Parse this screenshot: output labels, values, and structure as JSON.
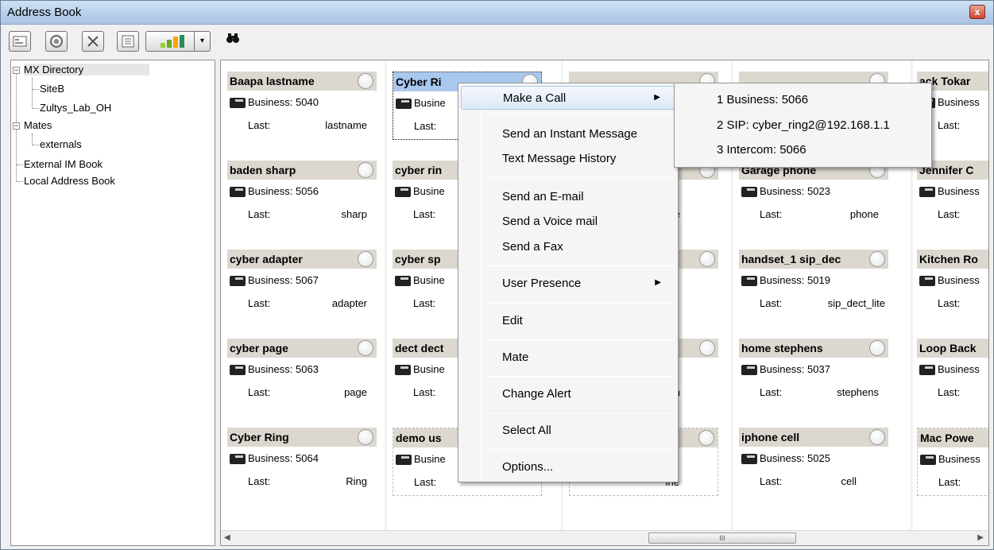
{
  "window": {
    "title": "Address Book",
    "close_label": "x"
  },
  "toolbar": {
    "buttons": [
      "new-contact-icon",
      "presence-icon",
      "delete-icon",
      "properties-icon",
      "chart-icon"
    ],
    "dropdown_arrow": "▾",
    "find_icon": "binoculars-icon"
  },
  "tree": {
    "items": [
      {
        "label": "MX Directory",
        "expander": "−"
      },
      {
        "label": "SiteB"
      },
      {
        "label": "Zultys_Lab_OH"
      },
      {
        "label": "Mates",
        "expander": "−"
      },
      {
        "label": "externals"
      },
      {
        "label": "External IM Book"
      },
      {
        "label": "Local Address Book"
      }
    ]
  },
  "contacts": [
    {
      "name": "Baapa lastname",
      "business_label": "Business:",
      "business": "5040",
      "last_label": "Last:",
      "last": "lastname"
    },
    {
      "name": "baden sharp",
      "business_label": "Business:",
      "business": "5056",
      "last_label": "Last:",
      "last": "sharp"
    },
    {
      "name": "cyber adapter",
      "business_label": "Business:",
      "business": "5067",
      "last_label": "Last:",
      "last": "adapter"
    },
    {
      "name": "cyber page",
      "business_label": "Business:",
      "business": "5063",
      "last_label": "Last:",
      "last": "page"
    },
    {
      "name": "Cyber Ring",
      "business_label": "Business:",
      "business": "5064",
      "last_label": "Last:",
      "last": "Ring"
    },
    {
      "name": "Cyber Ri",
      "business_label": "Busine",
      "last_label": "Last:"
    },
    {
      "name": "cyber rin",
      "business_label": "Busine",
      "last_label": "Last:"
    },
    {
      "name": "cyber sp",
      "business_label": "Busine",
      "last_label": "Last:"
    },
    {
      "name": "dect dect",
      "business_label": "Busine",
      "last_label": "Last:"
    },
    {
      "name": "demo us",
      "business_label": "Busine",
      "last_label": "Last:"
    },
    {
      "fragment": "e"
    },
    {
      "fragment": "n"
    },
    {
      "fragment": "ine"
    },
    {
      "name": "Garage phone",
      "business_label": "Business:",
      "business": "5023",
      "last_label": "Last:",
      "last": "phone"
    },
    {
      "name": "handset_1 sip_dec",
      "business_label": "Business:",
      "business": "5019",
      "last_label": "Last:",
      "last": "sip_dect_lite"
    },
    {
      "name": "home stephens",
      "business_label": "Business:",
      "business": "5037",
      "last_label": "Last:",
      "last": "stephens"
    },
    {
      "name": "iphone cell",
      "business_label": "Business:",
      "business": "5025",
      "last_label": "Last:",
      "last": "cell"
    },
    {
      "name": "ack Tokar",
      "business_label": "Business",
      "last_label": "Last:"
    },
    {
      "name": "Jennifer C",
      "business_label": "Business",
      "last_label": "Last:"
    },
    {
      "name": "Kitchen Ro",
      "business_label": "Business",
      "last_label": "Last:"
    },
    {
      "name": "Loop Back",
      "business_label": "Business",
      "last_label": "Last:"
    },
    {
      "name": "Mac Powe",
      "business_label": "Business",
      "last_label": "Last:"
    }
  ],
  "context_menu": {
    "items": [
      "Make a Call",
      "Send an Instant Message",
      "Text Message History",
      "Send an E-mail",
      "Send a Voice mail",
      "Send a Fax",
      "User Presence",
      "Edit",
      "Mate",
      "Change Alert",
      "Select All",
      "Options..."
    ],
    "submenu_arrow": "▶"
  },
  "call_submenu": {
    "items": [
      "1 Business: 5066",
      "2 SIP: cyber_ring2@192.168.1.1",
      "3 Intercom: 5066"
    ]
  },
  "scrollbar": {
    "left_arrow": "◀",
    "right_arrow": "▶",
    "grip": "III"
  }
}
